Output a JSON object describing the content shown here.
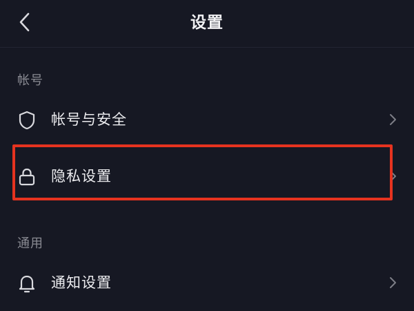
{
  "header": {
    "title": "设置",
    "back_icon": "chevron-left-icon"
  },
  "sections": [
    {
      "label": "帐号",
      "items": [
        {
          "label": "帐号与安全",
          "icon": "shield-icon"
        },
        {
          "label": "隐私设置",
          "icon": "lock-icon"
        }
      ]
    },
    {
      "label": "通用",
      "items": [
        {
          "label": "通知设置",
          "icon": "bell-icon"
        }
      ]
    }
  ],
  "colors": {
    "background": "#161823",
    "highlight": "#e6331f",
    "section_label": "#8a8b93",
    "text": "#ececef"
  }
}
